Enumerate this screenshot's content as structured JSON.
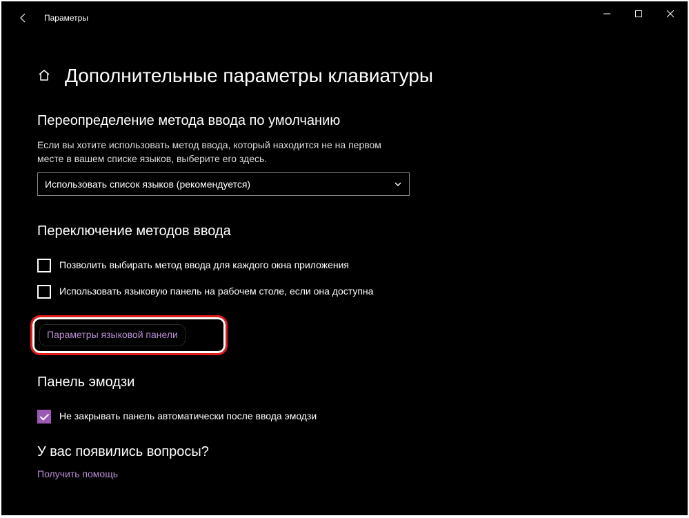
{
  "titlebar": {
    "app_title": "Параметры"
  },
  "page": {
    "title": "Дополнительные параметры клавиатуры"
  },
  "section1": {
    "title": "Переопределение метода ввода по умолчанию",
    "desc": "Если вы хотите использовать метод ввода, который находится не на первом месте в вашем списке языков, выберите его здесь.",
    "dropdown_value": "Использовать список языков (рекомендуется)"
  },
  "section2": {
    "title": "Переключение методов ввода",
    "cb1": {
      "label": "Позволить выбирать метод ввода для каждого окна приложения",
      "checked": false
    },
    "cb2": {
      "label": "Использовать языковую панель на рабочем столе, если она доступна",
      "checked": false
    },
    "link": "Параметры языковой панели"
  },
  "section3": {
    "title": "Панель эмодзи",
    "cb1": {
      "label": "Не закрывать панель автоматически после ввода эмодзи",
      "checked": true
    }
  },
  "questions": {
    "title": "У вас появились вопросы?",
    "help_link": "Получить помощь"
  }
}
